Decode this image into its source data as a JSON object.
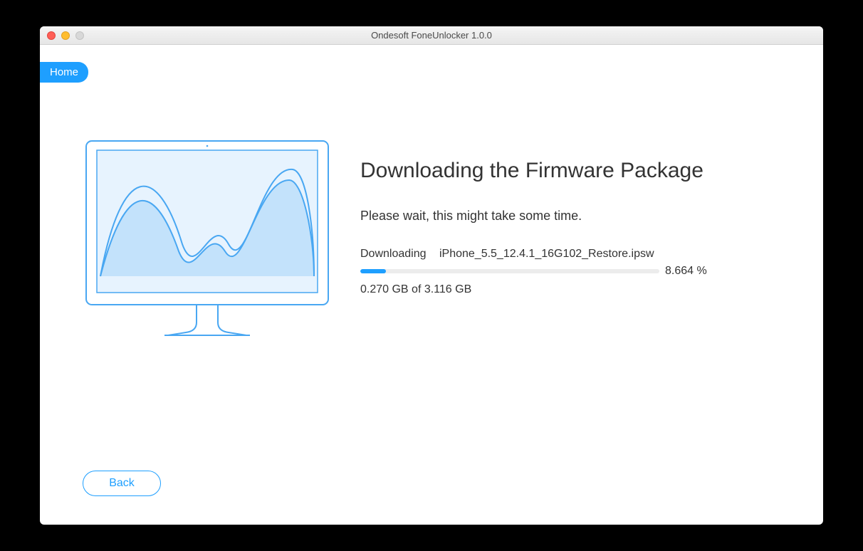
{
  "window": {
    "title": "Ondesoft FoneUnlocker 1.0.0"
  },
  "nav": {
    "home_label": "Home"
  },
  "main": {
    "heading": "Downloading the Firmware Package",
    "subtext": "Please wait, this might take some time.",
    "download_label": "Downloading",
    "download_filename": "iPhone_5.5_12.4.1_16G102_Restore.ipsw",
    "percent_text": "8.664 %",
    "percent_value": 8.664,
    "size_text": "0.270 GB of 3.116 GB"
  },
  "footer": {
    "back_label": "Back"
  },
  "colors": {
    "accent": "#1e9fff"
  }
}
